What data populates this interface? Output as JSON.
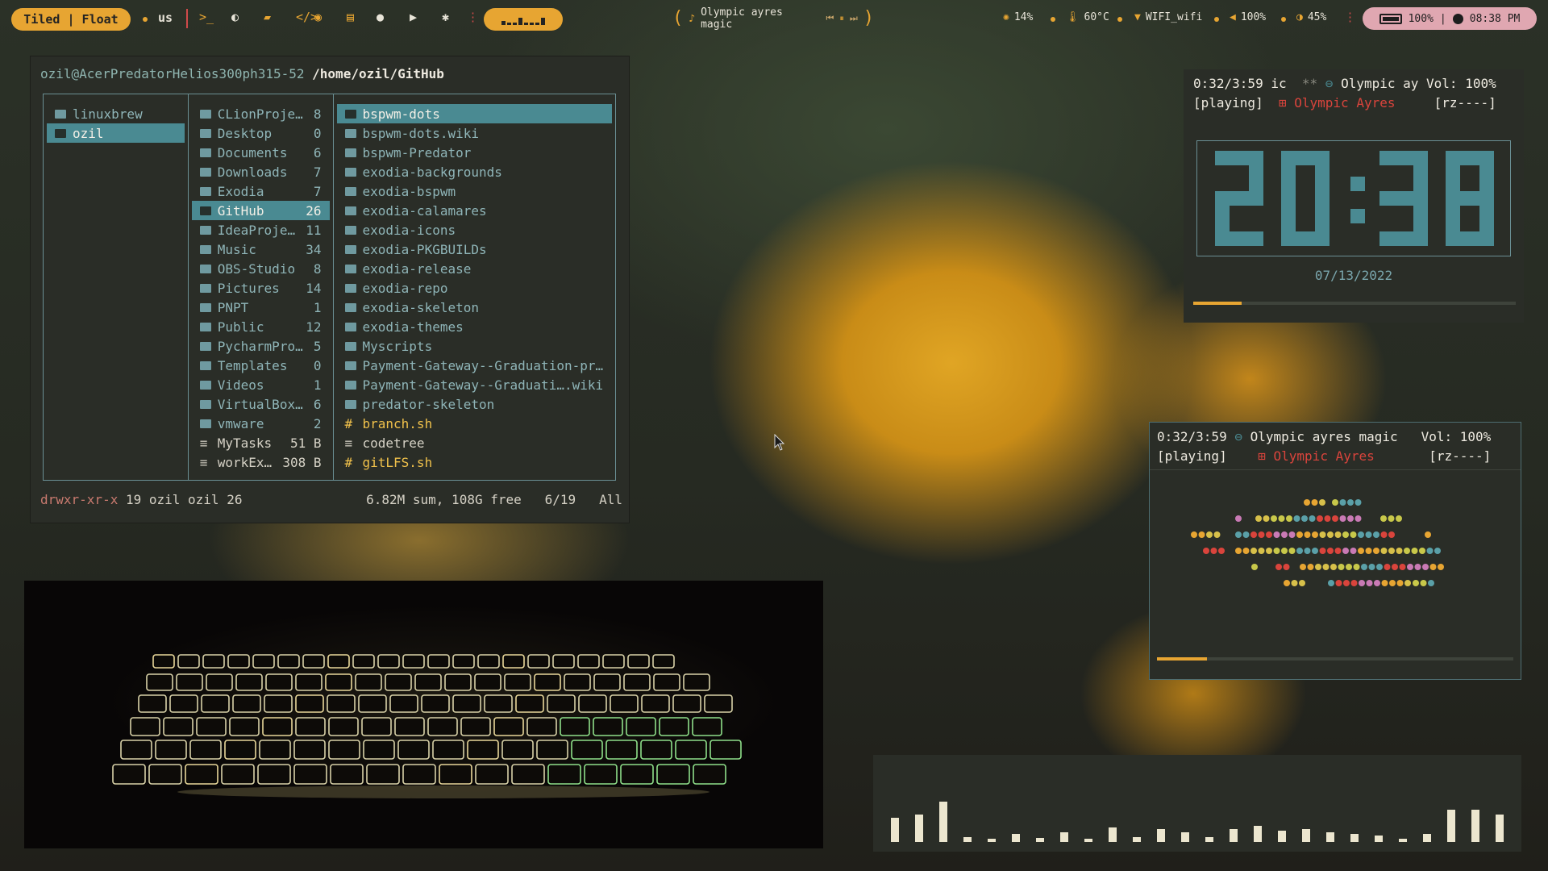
{
  "topbar": {
    "layout_mode": "Tiled | Float",
    "keyboard_layout": "us",
    "icons": [
      "terminal-icon",
      "firefox-icon",
      "folder-icon",
      "code-icon",
      "github-icon",
      "notes-icon",
      "chat-icon",
      "youtube-icon",
      "settings-icon",
      "menu-dots-icon"
    ],
    "media_title": "Olympic ayres magic",
    "cpu": "14%",
    "temperature": "60°C",
    "wifi": "WIFI_wifi",
    "volume": "100%",
    "brightness": "45%",
    "battery": "100%",
    "time": "08:38 PM"
  },
  "file_manager": {
    "user_host": "ozil@AcerPredatorHelios300ph315-52",
    "path": "/home/ozil/GitHub",
    "parent_column": [
      {
        "name": "linuxbrew",
        "selected": false
      },
      {
        "name": "ozil",
        "selected": true
      }
    ],
    "current_column": [
      {
        "name": "CLionProje…",
        "count": "8",
        "kind": "dir"
      },
      {
        "name": "Desktop",
        "count": "0",
        "kind": "dir"
      },
      {
        "name": "Documents",
        "count": "6",
        "kind": "dir"
      },
      {
        "name": "Downloads",
        "count": "7",
        "kind": "dir"
      },
      {
        "name": "Exodia",
        "count": "7",
        "kind": "dir"
      },
      {
        "name": "GitHub",
        "count": "26",
        "kind": "dir",
        "selected": true
      },
      {
        "name": "IdeaProje…",
        "count": "11",
        "kind": "dir"
      },
      {
        "name": "Music",
        "count": "34",
        "kind": "dir"
      },
      {
        "name": "OBS-Studio",
        "count": "8",
        "kind": "dir"
      },
      {
        "name": "Pictures",
        "count": "14",
        "kind": "dir"
      },
      {
        "name": "PNPT",
        "count": "1",
        "kind": "dir"
      },
      {
        "name": "Public",
        "count": "12",
        "kind": "dir"
      },
      {
        "name": "PycharmPro…",
        "count": "5",
        "kind": "dir"
      },
      {
        "name": "Templates",
        "count": "0",
        "kind": "dir"
      },
      {
        "name": "Videos",
        "count": "1",
        "kind": "dir"
      },
      {
        "name": "VirtualBox…",
        "count": "6",
        "kind": "dir"
      },
      {
        "name": "vmware",
        "count": "2",
        "kind": "dir"
      },
      {
        "name": "MyTasks",
        "count": "51 B",
        "kind": "file"
      },
      {
        "name": "workEx…",
        "count": "308 B",
        "kind": "file"
      }
    ],
    "preview_column": [
      {
        "name": "bspwm-dots",
        "kind": "dir",
        "selected": true
      },
      {
        "name": "bspwm-dots.wiki",
        "kind": "dir"
      },
      {
        "name": "bspwm-Predator",
        "kind": "dir"
      },
      {
        "name": "exodia-backgrounds",
        "kind": "dir"
      },
      {
        "name": "exodia-bspwm",
        "kind": "dir"
      },
      {
        "name": "exodia-calamares",
        "kind": "dir"
      },
      {
        "name": "exodia-icons",
        "kind": "dir"
      },
      {
        "name": "exodia-PKGBUILDs",
        "kind": "dir"
      },
      {
        "name": "exodia-release",
        "kind": "dir"
      },
      {
        "name": "exodia-repo",
        "kind": "dir"
      },
      {
        "name": "exodia-skeleton",
        "kind": "dir"
      },
      {
        "name": "exodia-themes",
        "kind": "dir"
      },
      {
        "name": "Myscripts",
        "kind": "dir"
      },
      {
        "name": "Payment-Gateway--Graduation-pr…",
        "kind": "dir"
      },
      {
        "name": "Payment-Gateway--Graduati….wiki",
        "kind": "dir"
      },
      {
        "name": "predator-skeleton",
        "kind": "dir"
      },
      {
        "name": "branch.sh",
        "kind": "script"
      },
      {
        "name": "codetree",
        "kind": "file"
      },
      {
        "name": "gitLFS.sh",
        "kind": "script"
      }
    ],
    "status": {
      "permissions": "drwxr-xr-x",
      "details": "19 ozil ozil 26",
      "summary": "6.82M sum, 108G free",
      "position": "6/19",
      "scroll": "All"
    }
  },
  "player_top": {
    "line1": {
      "time": "0:32/3:59",
      "extra": "ic",
      "stars": "**",
      "title": "Olympic ay",
      "volume": "Vol: 100%"
    },
    "line2": {
      "state": "[playing]",
      "artist": "Olympic Ayres",
      "flags": "[rz----]"
    },
    "clock": "20:38",
    "date": "07/13/2022",
    "progress": 0.15
  },
  "player_bottom": {
    "line1": {
      "time": "0:32/3:59",
      "title": "Olympic ayres magic",
      "volume": "Vol: 100%"
    },
    "line2": {
      "state": "[playing]",
      "artist": "Olympic Ayres",
      "flags": "[rz----]"
    },
    "progress": 0.14
  },
  "visualizer": {
    "levels": [
      0.3,
      0.34,
      0.5,
      0.06,
      0.02,
      0.1,
      0.05,
      0.12,
      0.03,
      0.18,
      0.06,
      0.16,
      0.12,
      0.06,
      0.16,
      0.2,
      0.14,
      0.16,
      0.12,
      0.1,
      0.08,
      0.02,
      0.1,
      0.4,
      0.4,
      0.34
    ]
  },
  "colors": {
    "accent": "#e7a532",
    "teal": "#4a8a92",
    "red": "#d9443c",
    "battery_pill": "#e0a7b1"
  }
}
